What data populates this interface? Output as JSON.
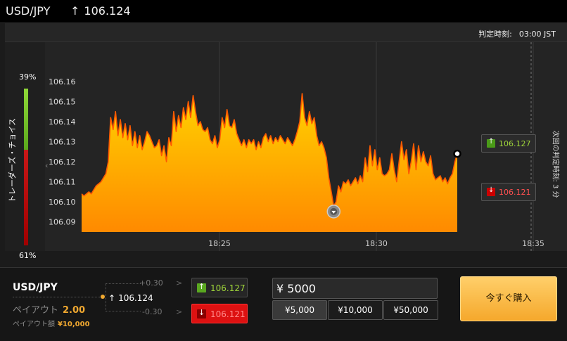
{
  "header": {
    "pair": "USD/JPY",
    "price_arrow": "↑",
    "price": "106.124"
  },
  "expiry": {
    "label": "判定時刻:",
    "time": "03:00 JST"
  },
  "traders_choice": {
    "label": "トレーダーズ・チョイス",
    "up_pct": "39%",
    "down_pct": "61%",
    "up_fraction": 0.39
  },
  "next_expiry": {
    "label": "次回の判定時刻: 3 分"
  },
  "collapse_icon": "‹",
  "tags": {
    "call_price": "106.127",
    "put_price": "106.121",
    "call_icon": "arrow-up",
    "put_icon": "arrow-down"
  },
  "chart_data": {
    "type": "area",
    "y_ticks": [
      "106.16",
      "106.15",
      "106.14",
      "106.13",
      "106.12",
      "106.11",
      "106.10",
      "106.09"
    ],
    "ylim": [
      106.085,
      106.168
    ],
    "x_ticks": [
      "18:25",
      "18:30",
      "18:35"
    ],
    "grid": true,
    "marker_price": 106.098,
    "current_price": 106.124,
    "series": [
      {
        "values": [
          106.104,
          106.103,
          106.104,
          106.105,
          106.104,
          106.106,
          106.108,
          106.109,
          106.11,
          106.112,
          106.114,
          106.12,
          106.142,
          106.136,
          106.145,
          106.133,
          106.141,
          106.132,
          106.139,
          106.131,
          106.138,
          106.128,
          106.135,
          106.127,
          106.133,
          106.126,
          106.13,
          106.135,
          106.133,
          106.13,
          106.127,
          106.128,
          106.131,
          106.123,
          106.128,
          106.12,
          106.132,
          106.128,
          106.145,
          106.135,
          106.143,
          106.137,
          106.147,
          106.141,
          106.15,
          106.142,
          106.153,
          106.145,
          106.138,
          106.14,
          106.136,
          106.135,
          106.137,
          106.131,
          106.129,
          106.133,
          106.127,
          106.131,
          106.142,
          106.137,
          106.146,
          106.138,
          106.137,
          106.141,
          106.134,
          106.131,
          106.128,
          106.131,
          106.127,
          106.131,
          106.129,
          106.131,
          106.126,
          106.13,
          106.127,
          106.132,
          106.134,
          106.13,
          106.133,
          106.129,
          106.132,
          106.13,
          106.133,
          106.131,
          106.129,
          106.132,
          106.13,
          106.128,
          106.131,
          106.135,
          106.14,
          106.154,
          106.142,
          106.138,
          106.145,
          106.139,
          106.142,
          106.133,
          106.128,
          106.13,
          106.127,
          106.122,
          106.112,
          106.105,
          106.098,
          106.1,
          106.108,
          106.105,
          106.11,
          106.109,
          106.111,
          106.108,
          106.11,
          106.112,
          106.109,
          106.113,
          106.11,
          106.122,
          106.115,
          106.128,
          106.118,
          106.126,
          106.116,
          106.122,
          106.114,
          106.113,
          106.114,
          106.116,
          106.124,
          106.116,
          106.11,
          106.12,
          106.13,
          106.121,
          106.126,
          106.114,
          106.12,
          106.129,
          106.116,
          106.128,
          106.12,
          106.125,
          106.12,
          106.118,
          106.123,
          106.114,
          106.111,
          106.112,
          106.113,
          106.11,
          106.112,
          106.109,
          106.112,
          106.114,
          106.12,
          106.124
        ]
      }
    ]
  },
  "footer": {
    "pair": "USD/JPY",
    "payout_label": "ペイアウト",
    "payout_value": "2.00",
    "amount_label": "ペイアウト額",
    "amount_value": "¥10,000",
    "current_arrow": "↑",
    "current_price": "106.124",
    "plus": "+0.30",
    "minus": "-0.30",
    "gt": ">",
    "call_price": "106.127",
    "put_price": "106.121",
    "input_value": "¥ 5000",
    "amounts": [
      "¥5,000",
      "¥10,000",
      "¥50,000"
    ],
    "buy_label": "今すぐ購入"
  },
  "colors": {
    "area_top": "#ffd200",
    "area_bottom": "#ff8a00",
    "line": "#ff5a00",
    "call": "#9fd53a",
    "put": "#ff5050",
    "payout": "#f0a830"
  }
}
